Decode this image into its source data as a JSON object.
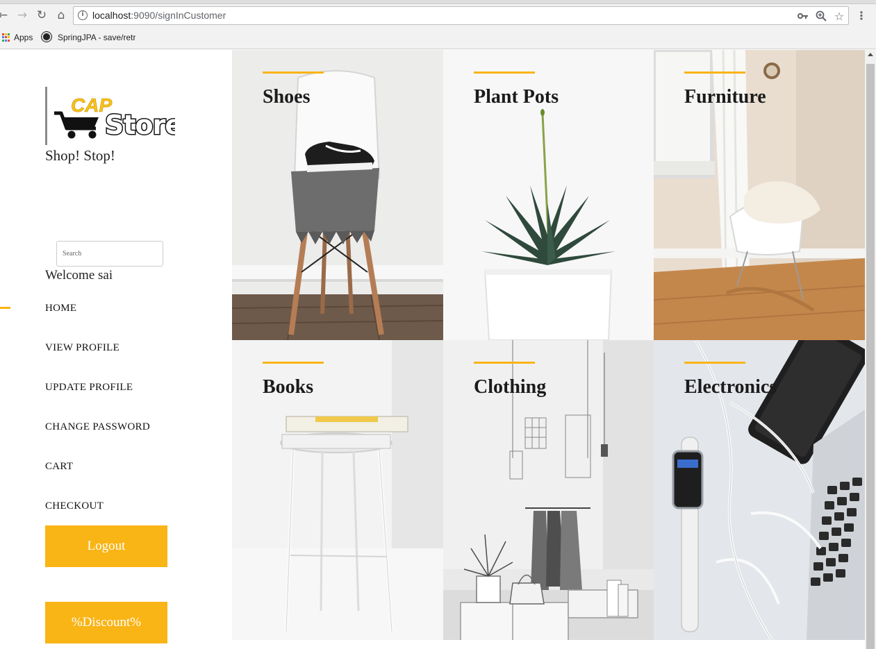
{
  "browser": {
    "url_host": "localhost",
    "url_path": ":9090/signInCustomer",
    "bookmarks": [
      {
        "label": "Apps"
      },
      {
        "label": "SpringJPA - save/retr"
      }
    ]
  },
  "brand": {
    "logo_top": "CAP",
    "logo_main": "Store",
    "tagline": "Shop! Stop!"
  },
  "search": {
    "placeholder": "Search"
  },
  "welcome": "Welcome sai",
  "nav": {
    "home": "HOME",
    "view_profile": "VIEW PROFILE",
    "update_profile": "UPDATE PROFILE",
    "change_password": "CHANGE PASSWORD",
    "cart": "CART",
    "checkout": "CHECKOUT"
  },
  "buttons": {
    "logout": "Logout",
    "discount": "%Discount%"
  },
  "categories": {
    "shoes": "Shoes",
    "plant_pots": "Plant Pots",
    "furniture": "Furniture",
    "books": "Books",
    "clothing": "Clothing",
    "electronics": "Electronics"
  },
  "colors": {
    "accent": "#f9b415",
    "text": "#1b1b1b"
  }
}
